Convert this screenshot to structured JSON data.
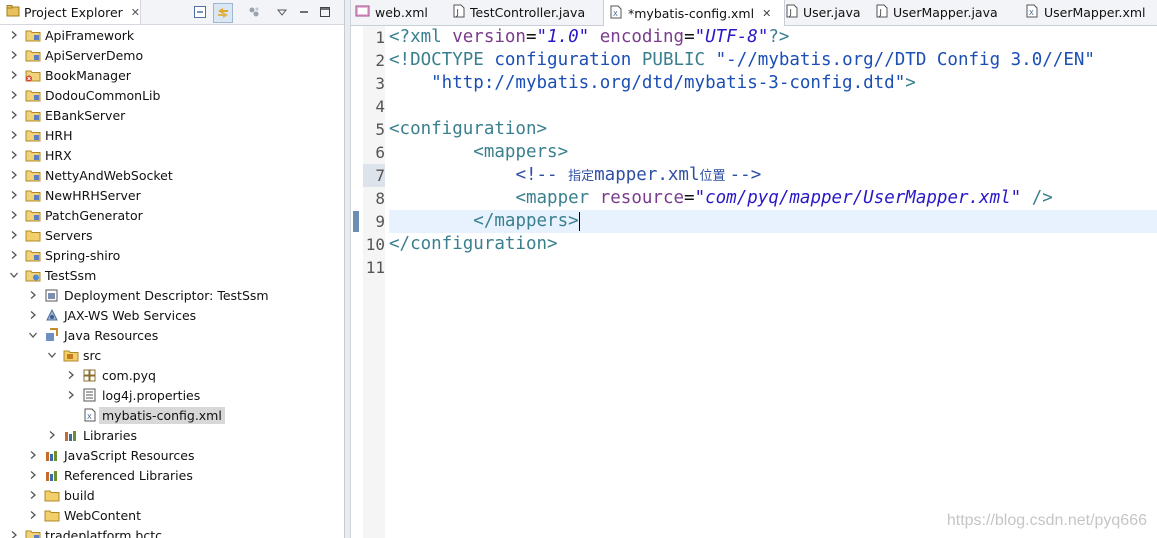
{
  "explorer": {
    "title": "Project Explorer",
    "close_glyph": "✕",
    "toolbar_icons": [
      "collapse-all-icon",
      "link-with-editor-icon",
      "focus-icon",
      "view-menu-icon",
      "minimize-icon",
      "maximize-icon"
    ],
    "items": [
      {
        "label": "ApiFramework",
        "depth": 0,
        "icon": "project-folder-icon",
        "expanded": false
      },
      {
        "label": "ApiServerDemo",
        "depth": 0,
        "icon": "project-folder-icon",
        "expanded": false
      },
      {
        "label": "BookManager",
        "depth": 0,
        "icon": "project-error-icon",
        "expanded": false
      },
      {
        "label": "DodouCommonLib",
        "depth": 0,
        "icon": "project-folder-icon",
        "expanded": false
      },
      {
        "label": "EBankServer",
        "depth": 0,
        "icon": "project-folder-icon",
        "expanded": false
      },
      {
        "label": "HRH",
        "depth": 0,
        "icon": "project-folder-icon",
        "expanded": false
      },
      {
        "label": "HRX",
        "depth": 0,
        "icon": "project-folder-icon",
        "expanded": false
      },
      {
        "label": "NettyAndWebSocket",
        "depth": 0,
        "icon": "project-folder-icon",
        "expanded": false
      },
      {
        "label": "NewHRHServer",
        "depth": 0,
        "icon": "project-folder-icon",
        "expanded": false
      },
      {
        "label": "PatchGenerator",
        "depth": 0,
        "icon": "project-folder-icon",
        "expanded": false
      },
      {
        "label": "Servers",
        "depth": 0,
        "icon": "folder-icon",
        "expanded": false
      },
      {
        "label": "Spring-shiro",
        "depth": 0,
        "icon": "project-folder-icon",
        "expanded": false
      },
      {
        "label": "TestSsm",
        "depth": 0,
        "icon": "web-project-icon",
        "expanded": true
      },
      {
        "label": "Deployment Descriptor: TestSsm",
        "depth": 1,
        "icon": "deployment-descriptor-icon",
        "expanded": false
      },
      {
        "label": "JAX-WS Web Services",
        "depth": 1,
        "icon": "web-services-icon",
        "expanded": false
      },
      {
        "label": "Java Resources",
        "depth": 1,
        "icon": "java-resources-icon",
        "expanded": true
      },
      {
        "label": "src",
        "depth": 2,
        "icon": "source-folder-icon",
        "expanded": true
      },
      {
        "label": "com.pyq",
        "depth": 3,
        "icon": "package-icon",
        "expanded": false
      },
      {
        "label": "log4j.properties",
        "depth": 3,
        "icon": "properties-file-icon",
        "expanded": false
      },
      {
        "label": "mybatis-config.xml",
        "depth": 3,
        "icon": "xml-file-icon",
        "expanded": null,
        "selected": true
      },
      {
        "label": "Libraries",
        "depth": 2,
        "icon": "libraries-icon",
        "expanded": false
      },
      {
        "label": "JavaScript Resources",
        "depth": 1,
        "icon": "libraries-icon",
        "expanded": false
      },
      {
        "label": "Referenced Libraries",
        "depth": 1,
        "icon": "libraries-icon",
        "expanded": false
      },
      {
        "label": "build",
        "depth": 1,
        "icon": "folder-icon",
        "expanded": false
      },
      {
        "label": "WebContent",
        "depth": 1,
        "icon": "folder-icon",
        "expanded": false
      },
      {
        "label": "tradeplatform.bctc",
        "depth": 0,
        "icon": "project-folder-icon",
        "expanded": false
      }
    ]
  },
  "editor": {
    "tabs": [
      {
        "label": "web.xml",
        "icon": "web-xml-icon",
        "active": false,
        "closable": false
      },
      {
        "label": "TestController.java",
        "icon": "java-file-icon",
        "active": false,
        "closable": false
      },
      {
        "label": "*mybatis-config.xml",
        "icon": "xml-file-icon",
        "active": true,
        "closable": true
      },
      {
        "label": "User.java",
        "icon": "java-file-icon",
        "active": false,
        "closable": false
      },
      {
        "label": "UserMapper.java",
        "icon": "java-file-icon",
        "active": false,
        "closable": false
      },
      {
        "label": "UserMapper.xml",
        "icon": "xml-file-icon",
        "active": false,
        "closable": false
      }
    ],
    "close_glyph": "✕",
    "line_numbers": [
      "1",
      "2",
      "3",
      "4",
      "5",
      "6",
      "7",
      "8",
      "9",
      "10",
      "11"
    ],
    "current_line": "9",
    "lines": [
      [
        {
          "c": "t-pi",
          "t": "<?xml "
        },
        {
          "c": "t-attr",
          "t": "version"
        },
        {
          "c": "t-plain",
          "t": "="
        },
        {
          "c": "t-str",
          "t": "\"1.0\""
        },
        {
          "c": "t-plain",
          "t": " "
        },
        {
          "c": "t-attr",
          "t": "encoding"
        },
        {
          "c": "t-plain",
          "t": "="
        },
        {
          "c": "t-str",
          "t": "\"UTF-8\""
        },
        {
          "c": "t-pi",
          "t": "?>"
        }
      ],
      [
        {
          "c": "t-tag",
          "t": "<!DOCTYPE "
        },
        {
          "c": "t-kw",
          "t": "configuration "
        },
        {
          "c": "t-tag",
          "t": "PUBLIC "
        },
        {
          "c": "t-kw",
          "t": "\"-//mybatis.org//DTD Config 3.0//EN\""
        }
      ],
      [
        {
          "c": "t-kw",
          "t": "    \"http://mybatis.org/dtd/mybatis-3-config.dtd\""
        },
        {
          "c": "t-tag",
          "t": ">"
        }
      ],
      [],
      [
        {
          "c": "t-tag",
          "t": "<configuration>"
        }
      ],
      [
        {
          "c": "t-plain",
          "t": "        "
        },
        {
          "c": "t-tag",
          "t": "<mappers>"
        }
      ],
      [
        {
          "c": "t-plain",
          "t": "            "
        },
        {
          "c": "t-comment",
          "t": "<!-- "
        },
        {
          "c": "t-comment-cjk",
          "t": "指定"
        },
        {
          "c": "t-comment",
          "t": "mapper.xml"
        },
        {
          "c": "t-comment-cjk",
          "t": "位置 "
        },
        {
          "c": "t-comment",
          "t": "-->"
        }
      ],
      [
        {
          "c": "t-plain",
          "t": "            "
        },
        {
          "c": "t-tag",
          "t": "<mapper "
        },
        {
          "c": "t-attr",
          "t": "resource"
        },
        {
          "c": "t-plain",
          "t": "="
        },
        {
          "c": "t-str",
          "t": "\"com/pyq/mapper/UserMapper.xml\""
        },
        {
          "c": "t-plain",
          "t": " "
        },
        {
          "c": "t-tag",
          "t": "/>"
        }
      ],
      [
        {
          "c": "t-plain",
          "t": "        "
        },
        {
          "c": "t-tag",
          "t": "</mappers>"
        }
      ],
      [
        {
          "c": "t-tag",
          "t": "</configuration>"
        }
      ],
      []
    ]
  },
  "watermark": "https://blog.csdn.net/pyq666"
}
